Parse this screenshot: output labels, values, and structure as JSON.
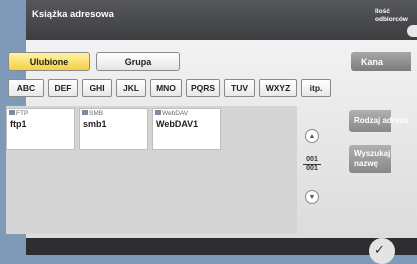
{
  "window": {
    "title": "Książka adresowa",
    "recipients_label": "Ilość\nodbiorców"
  },
  "tabs": {
    "favorites": "Ulubione",
    "group": "Grupa",
    "kana": "Kana"
  },
  "index_keys": [
    "ABC",
    "DEF",
    "GHI",
    "JKL",
    "MNO",
    "PQRS",
    "TUV",
    "WXYZ",
    "itp."
  ],
  "entries": [
    {
      "type": "FTP",
      "name": "ftp1"
    },
    {
      "type": "SMB",
      "name": "smb1"
    },
    {
      "type": "WebDAV",
      "name": "WebDAV1"
    }
  ],
  "pagination": {
    "current": "001",
    "total": "001"
  },
  "side_buttons": {
    "address_type": "Rodzaj adresu",
    "search_name": "Wyszukaj\nnazwę"
  }
}
